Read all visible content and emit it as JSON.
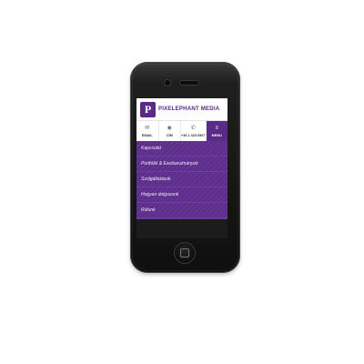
{
  "brand": {
    "name": "PIXELEPHANT MEDIA",
    "logo_letter": "P",
    "accent_color": "#5a2a87"
  },
  "nav": [
    {
      "label": "EMAIL",
      "icon": "mail-icon",
      "glyph": "✉"
    },
    {
      "label": "CÍM",
      "icon": "location-icon",
      "glyph": "◉"
    },
    {
      "label": "+36 1 323 6507",
      "icon": "phone-icon",
      "glyph": "✆"
    },
    {
      "label": "MENU",
      "icon": "menu-icon",
      "glyph": "≡"
    }
  ],
  "menu": [
    {
      "label": "Kapcsolat"
    },
    {
      "label": "Portfólió & Esettanulmányok"
    },
    {
      "label": "Szolgáltatások"
    },
    {
      "label": "Hogyan dolgozunk"
    },
    {
      "label": "Rólunk"
    }
  ]
}
